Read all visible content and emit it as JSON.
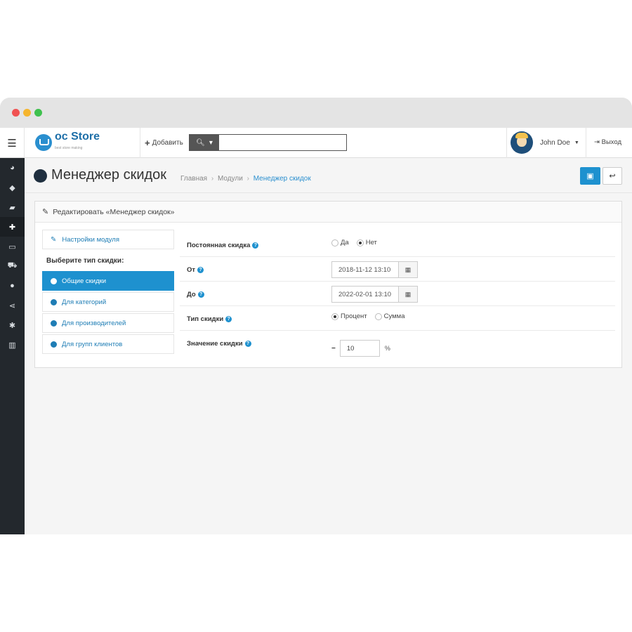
{
  "header": {
    "logo_text": "oc Store",
    "logo_sub": "best store making",
    "add_label": "Добавить",
    "search_placeholder": "",
    "user_name": "John Doe",
    "logout_label": "Выход"
  },
  "sidebar": {
    "items": [
      {
        "icon": "dashboard-icon",
        "glyph": "◕"
      },
      {
        "icon": "tags-icon",
        "glyph": "◆"
      },
      {
        "icon": "book-icon",
        "glyph": "▰"
      },
      {
        "icon": "puzzle-icon",
        "glyph": "✚"
      },
      {
        "icon": "monitor-icon",
        "glyph": "▭"
      },
      {
        "icon": "cart-icon",
        "glyph": "⛟"
      },
      {
        "icon": "user-icon",
        "glyph": "●"
      },
      {
        "icon": "share-icon",
        "glyph": "⋖"
      },
      {
        "icon": "gear-icon",
        "glyph": "✱"
      },
      {
        "icon": "bar-chart-icon",
        "glyph": "▥"
      }
    ]
  },
  "page": {
    "title": "Менеджер скидок",
    "breadcrumbs": [
      "Главная",
      "Модули",
      "Менеджер скидок"
    ]
  },
  "panel": {
    "heading": "Редактировать «Менеджер скидок»"
  },
  "tabs": {
    "settings": "Настройки модуля",
    "choose_label": "Выберите тип скидки:",
    "general": "Общие скидки",
    "categories": "Для категорий",
    "manufacturers": "Для производителей",
    "customer_groups": "Для групп клиентов"
  },
  "form": {
    "permanent": {
      "label": "Постоянная скидка",
      "yes": "Да",
      "no": "Нет",
      "selected": "Нет"
    },
    "from": {
      "label": "От",
      "value": "2018-11-12 13:10"
    },
    "to": {
      "label": "До",
      "value": "2022-02-01 13:10"
    },
    "type": {
      "label": "Тип скидки",
      "percent": "Процент",
      "sum": "Сумма",
      "selected": "Процент"
    },
    "value": {
      "label": "Значение скидки",
      "sign": "−",
      "amount": "10",
      "unit": "%"
    }
  },
  "colors": {
    "accent": "#1e91cf",
    "sidebar_bg": "#23282d"
  }
}
